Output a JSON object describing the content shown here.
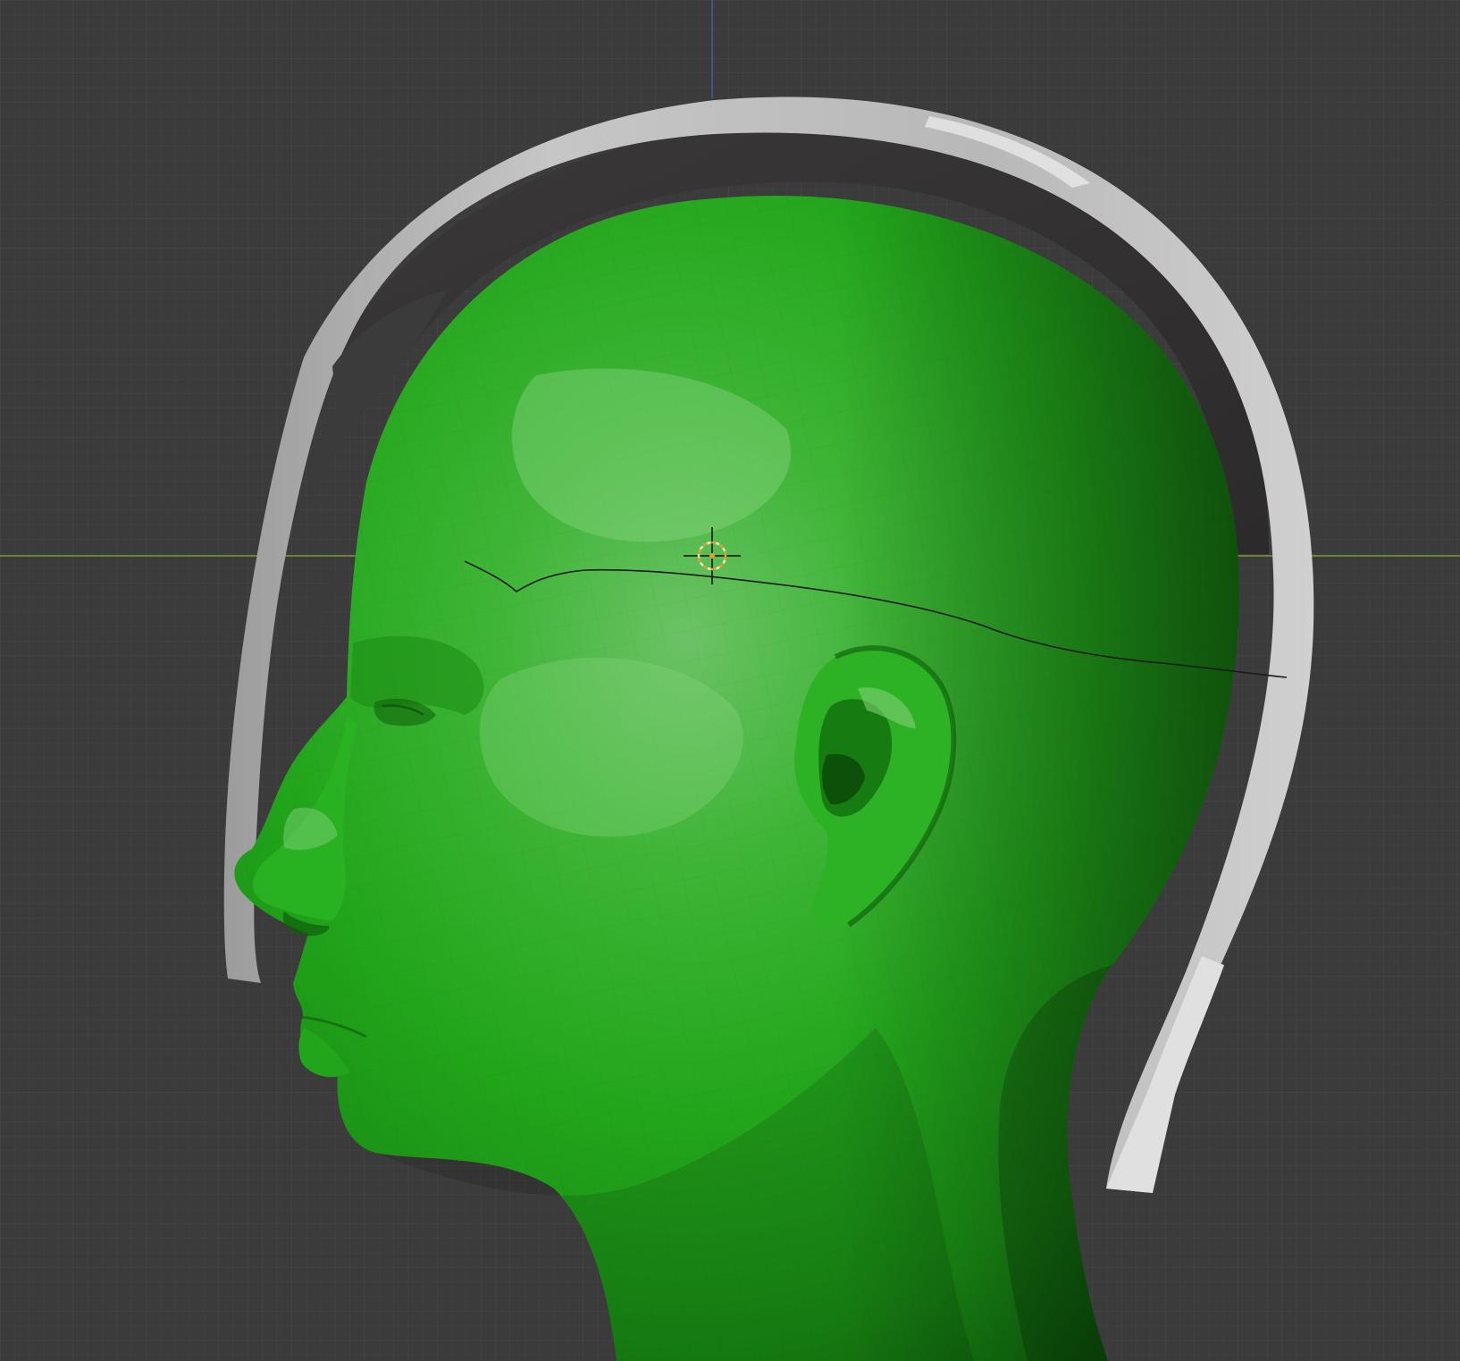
{
  "viewport": {
    "name": "3D Viewport",
    "view": "side-orthographic",
    "background_color": "#3b3b3b",
    "grid_line_color": "#454545",
    "x_axis_color": "#7c9a35",
    "z_axis_color": "#3a5ea6"
  },
  "objects": [
    {
      "name": "head-mesh",
      "color": "#22a81a",
      "shading": "flat-solid"
    },
    {
      "name": "headband-shell",
      "color": "#bdbdbd",
      "shading": "flat-solid"
    },
    {
      "name": "cut-curve",
      "color": "#1a1a1a"
    }
  ],
  "cursor": {
    "icon": "3d-cursor-icon",
    "ring_color": "#e8a020"
  }
}
